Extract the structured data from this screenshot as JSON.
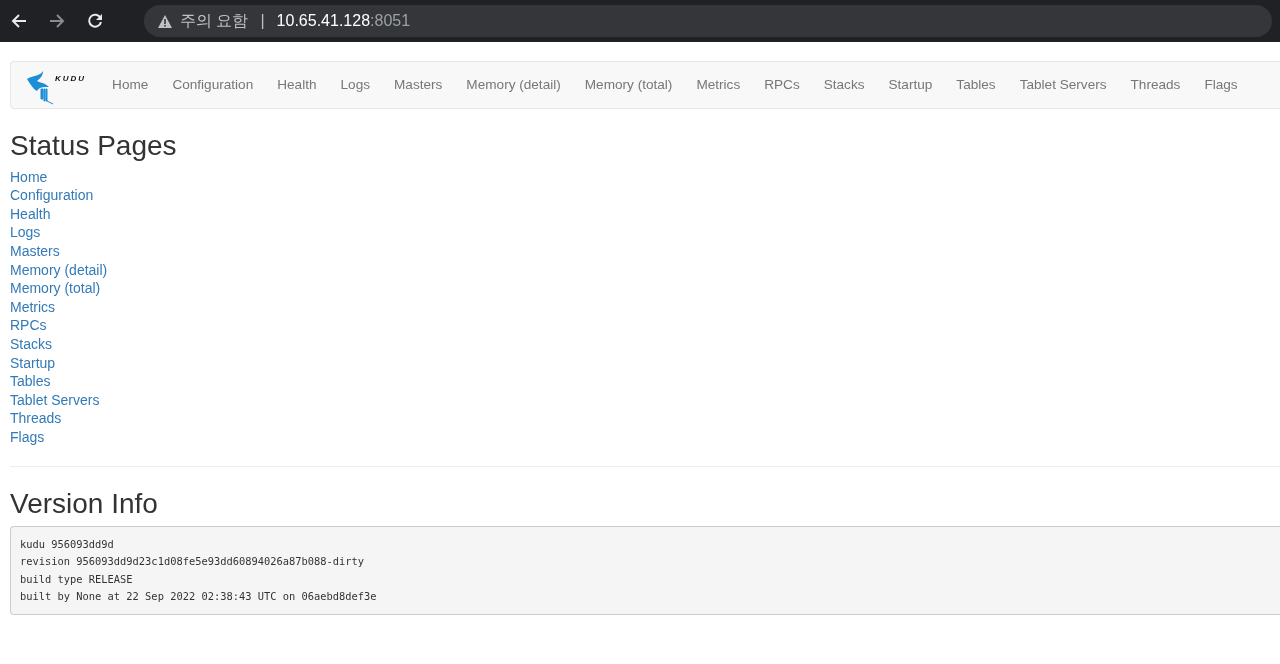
{
  "browser": {
    "warning": "주의 요함",
    "separator": "|",
    "host": "10.65.41.128",
    "port": ":8051"
  },
  "navbar": {
    "logo_text": "KUDU",
    "items": [
      "Home",
      "Configuration",
      "Health",
      "Logs",
      "Masters",
      "Memory (detail)",
      "Memory (total)",
      "Metrics",
      "RPCs",
      "Stacks",
      "Startup",
      "Tables",
      "Tablet Servers",
      "Threads",
      "Flags"
    ]
  },
  "status_pages": {
    "title": "Status Pages",
    "links": [
      "Home",
      "Configuration",
      "Health",
      "Logs",
      "Masters",
      "Memory (detail)",
      "Memory (total)",
      "Metrics",
      "RPCs",
      "Stacks",
      "Startup",
      "Tables",
      "Tablet Servers",
      "Threads",
      "Flags"
    ]
  },
  "version_info": {
    "title": "Version Info",
    "lines": [
      "kudu 956093dd9d",
      "revision 956093dd9d23c1d08fe5e93dd60894026a87b088-dirty",
      "build type RELEASE",
      "built by None at 22 Sep 2022 02:38:43 UTC on 06aebd8def3e"
    ]
  }
}
